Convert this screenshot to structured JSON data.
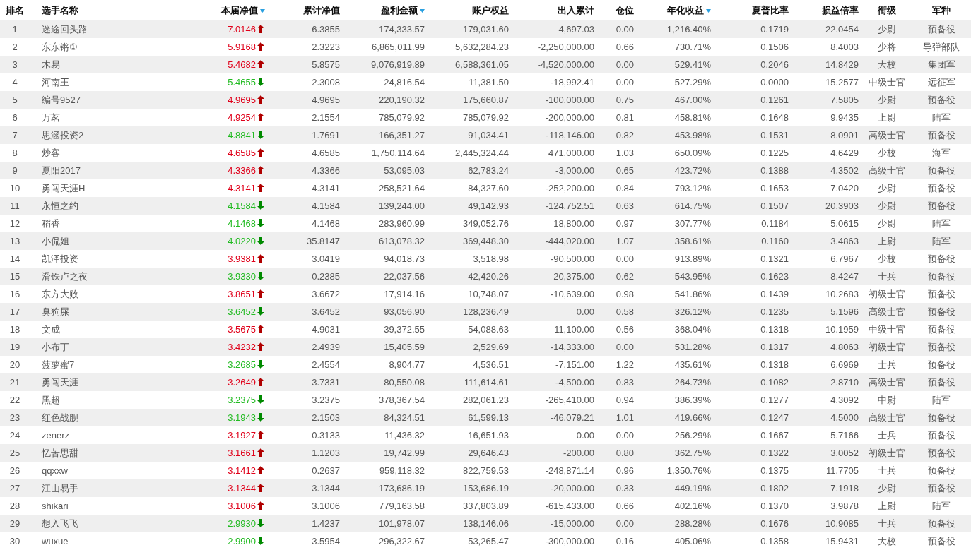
{
  "table": {
    "columns": [
      {
        "label": "排名",
        "sortable": false
      },
      {
        "label": "选手名称",
        "sortable": false
      },
      {
        "label": "本届净值",
        "sortable": true
      },
      {
        "label": "累计净值",
        "sortable": false
      },
      {
        "label": "盈利金额",
        "sortable": true
      },
      {
        "label": "账户权益",
        "sortable": false
      },
      {
        "label": "出入累计",
        "sortable": false
      },
      {
        "label": "仓位",
        "sortable": false
      },
      {
        "label": "年化收益",
        "sortable": true
      },
      {
        "label": "夏普比率",
        "sortable": false
      },
      {
        "label": "损益倍率",
        "sortable": false
      },
      {
        "label": "衔级",
        "sortable": false
      },
      {
        "label": "军种",
        "sortable": false
      }
    ],
    "rows": [
      {
        "rising": true,
        "cells": [
          "1",
          "迷途回头路",
          "7.0146",
          "6.3855",
          "174,333.57",
          "179,031.60",
          "4,697.03",
          "0.00",
          "1,216.40%",
          "0.1719",
          "22.0454",
          "少尉",
          "预备役"
        ]
      },
      {
        "rising": true,
        "cells": [
          "2",
          "东东锵①",
          "5.9168",
          "2.3223",
          "6,865,011.99",
          "5,632,284.23",
          "-2,250,000.00",
          "0.66",
          "730.71%",
          "0.1506",
          "8.4003",
          "少将",
          "导弹部队"
        ]
      },
      {
        "rising": true,
        "cells": [
          "3",
          "木易",
          "5.4682",
          "5.8575",
          "9,076,919.89",
          "6,588,361.05",
          "-4,520,000.00",
          "0.00",
          "529.41%",
          "0.2046",
          "14.8429",
          "大校",
          "集团军"
        ]
      },
      {
        "rising": false,
        "cells": [
          "4",
          "河南王",
          "5.4655",
          "2.3008",
          "24,816.54",
          "11,381.50",
          "-18,992.41",
          "0.00",
          "527.29%",
          "0.0000",
          "15.2577",
          "中级士官",
          "远征军"
        ]
      },
      {
        "rising": true,
        "cells": [
          "5",
          "编号9527",
          "4.9695",
          "4.9695",
          "220,190.32",
          "175,660.87",
          "-100,000.00",
          "0.75",
          "467.00%",
          "0.1261",
          "7.5805",
          "少尉",
          "预备役"
        ]
      },
      {
        "rising": true,
        "cells": [
          "6",
          "万茗",
          "4.9254",
          "2.1554",
          "785,079.92",
          "785,079.92",
          "-200,000.00",
          "0.81",
          "458.81%",
          "0.1648",
          "9.9435",
          "上尉",
          "陆军"
        ]
      },
      {
        "rising": false,
        "cells": [
          "7",
          "思涵投资2",
          "4.8841",
          "1.7691",
          "166,351.27",
          "91,034.41",
          "-118,146.00",
          "0.82",
          "453.98%",
          "0.1531",
          "8.0901",
          "高级士官",
          "预备役"
        ]
      },
      {
        "rising": true,
        "cells": [
          "8",
          "炒客",
          "4.6585",
          "4.6585",
          "1,750,114.64",
          "2,445,324.44",
          "471,000.00",
          "1.03",
          "650.09%",
          "0.1225",
          "4.6429",
          "少校",
          "海军"
        ]
      },
      {
        "rising": true,
        "cells": [
          "9",
          "夏阳2017",
          "4.3366",
          "4.3366",
          "53,095.03",
          "62,783.24",
          "-3,000.00",
          "0.65",
          "423.72%",
          "0.1388",
          "4.3502",
          "高级士官",
          "预备役"
        ]
      },
      {
        "rising": true,
        "cells": [
          "10",
          "勇闯天涯H",
          "4.3141",
          "4.3141",
          "258,521.64",
          "84,327.60",
          "-252,200.00",
          "0.84",
          "793.12%",
          "0.1653",
          "7.0420",
          "少尉",
          "预备役"
        ]
      },
      {
        "rising": false,
        "cells": [
          "11",
          "永恒之约",
          "4.1584",
          "4.1584",
          "139,244.00",
          "49,142.93",
          "-124,752.51",
          "0.63",
          "614.75%",
          "0.1507",
          "20.3903",
          "少尉",
          "预备役"
        ]
      },
      {
        "rising": false,
        "cells": [
          "12",
          "稻香",
          "4.1468",
          "4.1468",
          "283,960.99",
          "349,052.76",
          "18,800.00",
          "0.97",
          "307.77%",
          "0.1184",
          "5.0615",
          "少尉",
          "陆军"
        ]
      },
      {
        "rising": false,
        "cells": [
          "13",
          "小侃姐",
          "4.0220",
          "35.8147",
          "613,078.32",
          "369,448.30",
          "-444,020.00",
          "1.07",
          "358.61%",
          "0.1160",
          "3.4863",
          "上尉",
          "陆军"
        ]
      },
      {
        "rising": true,
        "cells": [
          "14",
          "凯泽投资",
          "3.9381",
          "3.0419",
          "94,018.73",
          "3,518.98",
          "-90,500.00",
          "0.00",
          "913.89%",
          "0.1321",
          "6.7967",
          "少校",
          "预备役"
        ]
      },
      {
        "rising": false,
        "cells": [
          "15",
          "滑铁卢之夜",
          "3.9330",
          "0.2385",
          "22,037.56",
          "42,420.26",
          "20,375.00",
          "0.62",
          "543.95%",
          "0.1623",
          "8.4247",
          "士兵",
          "预备役"
        ]
      },
      {
        "rising": true,
        "cells": [
          "16",
          "东方大败",
          "3.8651",
          "3.6672",
          "17,914.16",
          "10,748.07",
          "-10,639.00",
          "0.98",
          "541.86%",
          "0.1439",
          "10.2683",
          "初级士官",
          "预备役"
        ]
      },
      {
        "rising": false,
        "cells": [
          "17",
          "臭狗屎",
          "3.6452",
          "3.6452",
          "93,056.90",
          "128,236.49",
          "0.00",
          "0.58",
          "326.12%",
          "0.1235",
          "5.1596",
          "高级士官",
          "预备役"
        ]
      },
      {
        "rising": true,
        "cells": [
          "18",
          "文成",
          "3.5675",
          "4.9031",
          "39,372.55",
          "54,088.63",
          "11,100.00",
          "0.56",
          "368.04%",
          "0.1318",
          "10.1959",
          "中级士官",
          "预备役"
        ]
      },
      {
        "rising": true,
        "cells": [
          "19",
          "小布丁",
          "3.4232",
          "2.4939",
          "15,405.59",
          "2,529.69",
          "-14,333.00",
          "0.00",
          "531.28%",
          "0.1317",
          "4.8063",
          "初级士官",
          "预备役"
        ]
      },
      {
        "rising": false,
        "cells": [
          "20",
          "菠萝蜜7",
          "3.2685",
          "2.4554",
          "8,904.77",
          "4,536.51",
          "-7,151.00",
          "1.22",
          "435.61%",
          "0.1318",
          "6.6969",
          "士兵",
          "预备役"
        ]
      },
      {
        "rising": true,
        "cells": [
          "21",
          "勇闯天涯",
          "3.2649",
          "3.7331",
          "80,550.08",
          "111,614.61",
          "-4,500.00",
          "0.83",
          "264.73%",
          "0.1082",
          "2.8710",
          "高级士官",
          "预备役"
        ]
      },
      {
        "rising": false,
        "cells": [
          "22",
          "黑超",
          "3.2375",
          "3.2375",
          "378,367.54",
          "282,061.23",
          "-265,410.00",
          "0.94",
          "386.39%",
          "0.1277",
          "4.3092",
          "中尉",
          "陆军"
        ]
      },
      {
        "rising": false,
        "cells": [
          "23",
          "红色战舰",
          "3.1943",
          "2.1503",
          "84,324.51",
          "61,599.13",
          "-46,079.21",
          "1.01",
          "419.66%",
          "0.1247",
          "4.5000",
          "高级士官",
          "预备役"
        ]
      },
      {
        "rising": true,
        "cells": [
          "24",
          "zenerz",
          "3.1927",
          "0.3133",
          "11,436.32",
          "16,651.93",
          "0.00",
          "0.00",
          "256.29%",
          "0.1667",
          "5.7166",
          "士兵",
          "预备役"
        ]
      },
      {
        "rising": true,
        "cells": [
          "25",
          "忆苦思甜",
          "3.1661",
          "1.1203",
          "19,742.99",
          "29,646.43",
          "-200.00",
          "0.80",
          "362.75%",
          "0.1322",
          "3.0052",
          "初级士官",
          "预备役"
        ]
      },
      {
        "rising": true,
        "cells": [
          "26",
          "qqxxw",
          "3.1412",
          "0.2637",
          "959,118.32",
          "822,759.53",
          "-248,871.14",
          "0.96",
          "1,350.76%",
          "0.1375",
          "11.7705",
          "士兵",
          "预备役"
        ]
      },
      {
        "rising": true,
        "cells": [
          "27",
          "江山易手",
          "3.1344",
          "3.1344",
          "173,686.19",
          "153,686.19",
          "-20,000.00",
          "0.33",
          "449.19%",
          "0.1802",
          "7.1918",
          "少尉",
          "预备役"
        ]
      },
      {
        "rising": true,
        "cells": [
          "28",
          "shikari",
          "3.1006",
          "3.1006",
          "779,163.58",
          "337,803.89",
          "-615,433.00",
          "0.66",
          "402.16%",
          "0.1370",
          "3.9878",
          "上尉",
          "陆军"
        ]
      },
      {
        "rising": false,
        "cells": [
          "29",
          "想入飞飞",
          "2.9930",
          "1.4237",
          "101,978.07",
          "138,146.06",
          "-15,000.00",
          "0.00",
          "288.28%",
          "0.1676",
          "10.9085",
          "士兵",
          "预备役"
        ]
      },
      {
        "rising": false,
        "cells": [
          "30",
          "wuxue",
          "2.9900",
          "3.5954",
          "296,322.67",
          "53,265.47",
          "-300,000.00",
          "0.16",
          "405.06%",
          "0.1358",
          "15.9431",
          "大校",
          "预备役"
        ]
      }
    ]
  }
}
